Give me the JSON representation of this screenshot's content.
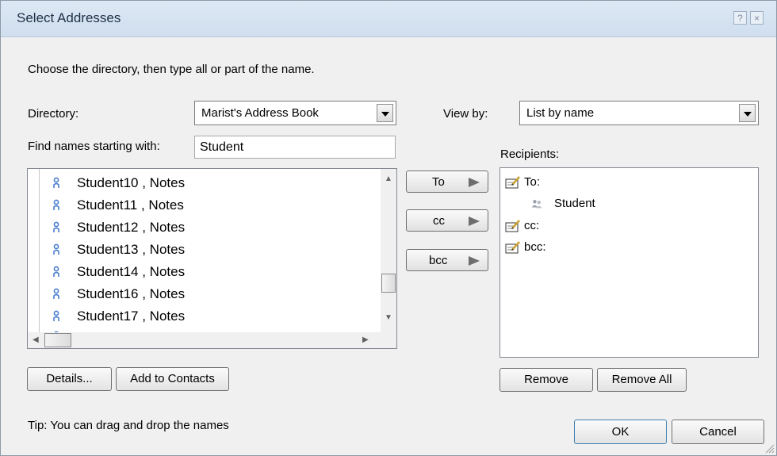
{
  "window": {
    "title": "Select Addresses",
    "help_glyph": "?",
    "close_glyph": "×"
  },
  "instructions": "Choose the directory, then type all or part of the name.",
  "directory": {
    "label": "Directory:",
    "value": "Marist's Address Book"
  },
  "view_by": {
    "label": "View by:",
    "value": "List by name"
  },
  "find": {
    "label": "Find names starting with:",
    "value": "Student"
  },
  "names": [
    "Student10 , Notes",
    "Student11 , Notes",
    "Student12 , Notes",
    "Student13 , Notes",
    "Student14 , Notes",
    "Student16 , Notes",
    "Student17 , Notes"
  ],
  "send_buttons": {
    "to": "To",
    "cc": "cc",
    "bcc": "bcc"
  },
  "recipients": {
    "label": "Recipients:",
    "to_label": "To:",
    "to_entry": "Student",
    "cc_label": "cc:",
    "bcc_label": "bcc:"
  },
  "buttons": {
    "details": "Details...",
    "add_to_contacts": "Add to Contacts",
    "remove": "Remove",
    "remove_all": "Remove All",
    "ok": "OK",
    "cancel": "Cancel"
  },
  "tip": "Tip: You can drag and drop the names",
  "colors": {
    "person_icon": "#4a7fd0",
    "group_icon": "#9aa0aa",
    "titlebar": "#d6e3f1"
  }
}
